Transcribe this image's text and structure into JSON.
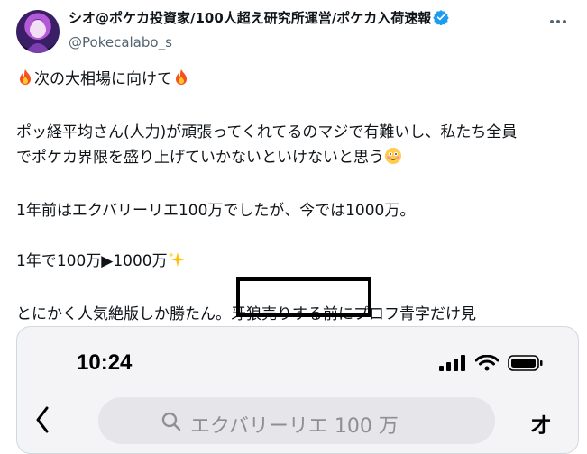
{
  "author": {
    "display_name": "シオ@ポケカ投資家/100人超え研究所運営/ポケカ入荷速報",
    "handle": "@Pokecalabo_s",
    "verified": true
  },
  "post": {
    "line1_text": "次の大相場に向けて",
    "line2": "ポッ経平均さん(人力)が頑張ってくれてるのマジで有難いし、私たち全員",
    "line3": "でポケカ界限を盛り上げていかないといけないと思う",
    "line4": "1年前はエクバリーリエ100万でしたが、今では1000万。",
    "line5": "1年で100万▶1000万",
    "line6_pre": "とにかく人気絶版しか勝たん。",
    "line6_highlight": "牙狼売りする前",
    "line6_post": "にプロフ青字だけ見"
  },
  "embed": {
    "time": "10:24",
    "search_text": "エクバリーリエ 100 万",
    "right_icon_text": "才"
  },
  "colors": {
    "text": "#0f1419",
    "secondary": "#536471",
    "verified": "#1d9bf0",
    "card_border": "#cfd9de"
  }
}
